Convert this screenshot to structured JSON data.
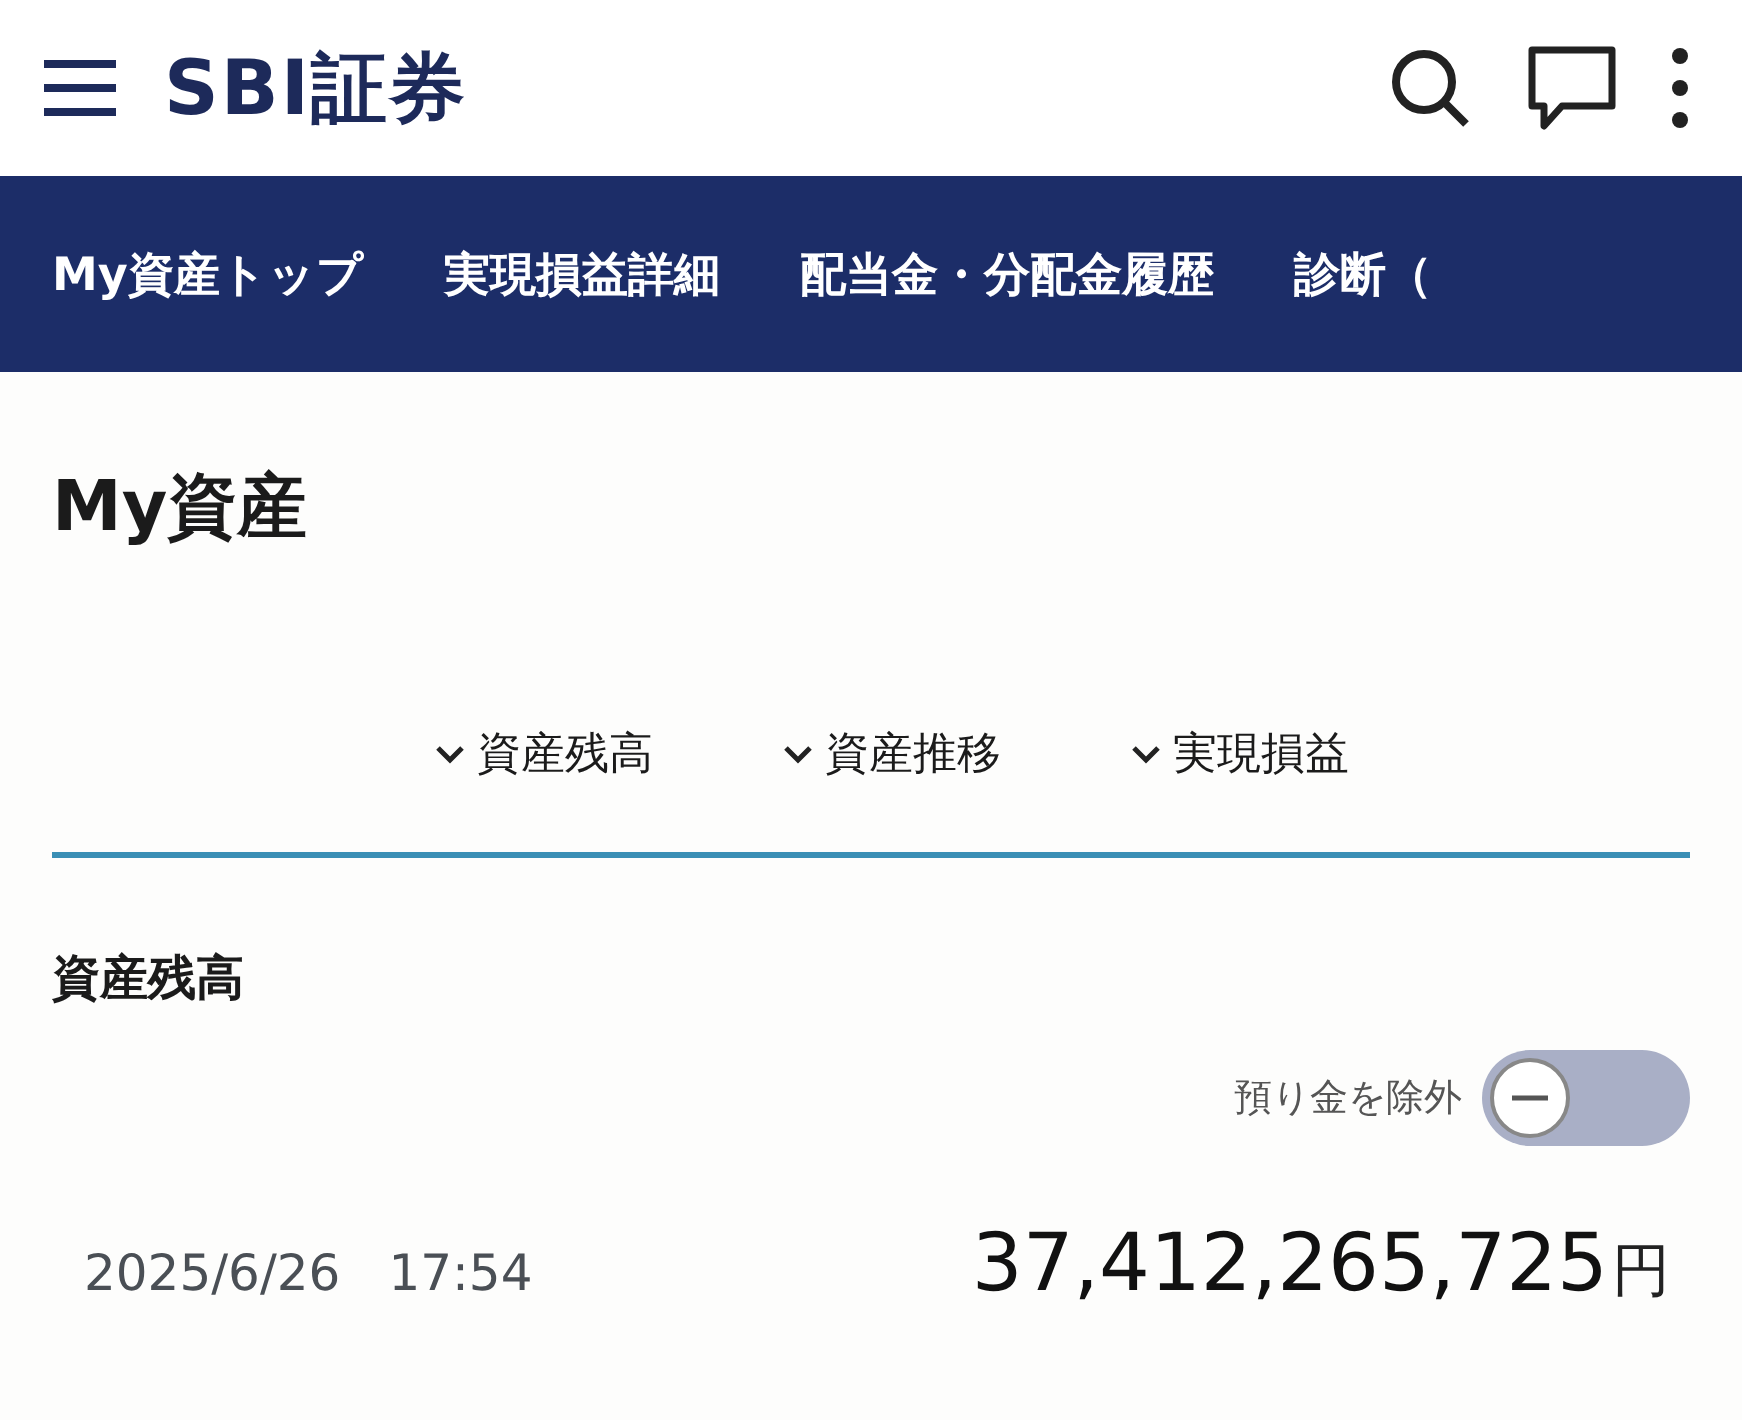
{
  "header": {
    "logo": "SBI証券"
  },
  "nav": [
    "My資産トップ",
    "実現損益詳細",
    "配当金・分配金履歴",
    "診断（"
  ],
  "page_title": "My資産",
  "anchors": [
    "資産残高",
    "資産推移",
    "実現損益"
  ],
  "section": {
    "title": "資産残高",
    "toggle": {
      "label": "預り金を除外",
      "on": false
    },
    "date": "2025/6/26",
    "time": "17:54",
    "amount": "37,412,265,725",
    "unit": "円"
  }
}
